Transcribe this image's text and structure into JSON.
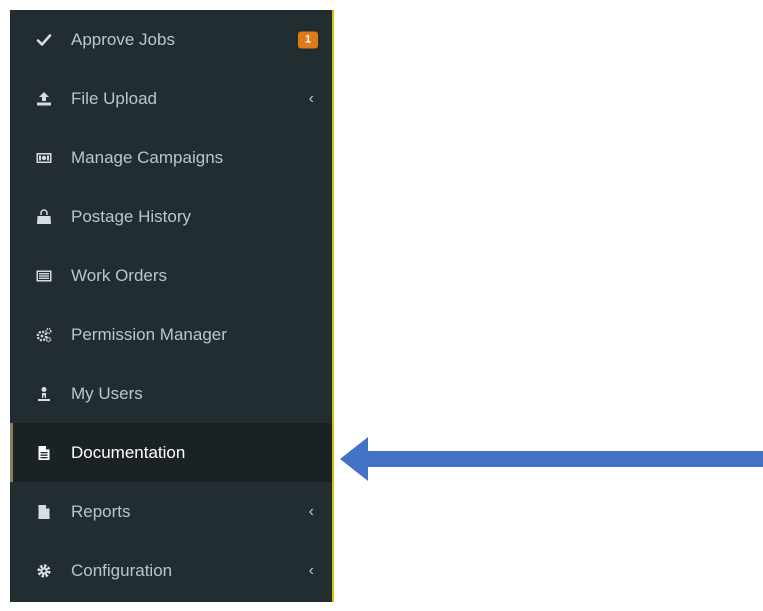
{
  "sidebar": {
    "items": [
      {
        "label": "Approve Jobs",
        "icon": "check-icon",
        "badge": "1"
      },
      {
        "label": "File Upload",
        "icon": "upload-icon",
        "chevron": "‹"
      },
      {
        "label": "Manage Campaigns",
        "icon": "money-icon"
      },
      {
        "label": "Postage History",
        "icon": "shopping-bag-icon"
      },
      {
        "label": "Work Orders",
        "icon": "list-alt-icon"
      },
      {
        "label": "Permission Manager",
        "icon": "cogs-icon"
      },
      {
        "label": "My Users",
        "icon": "user-icon"
      },
      {
        "label": "Documentation",
        "icon": "file-text-icon",
        "active": true
      },
      {
        "label": "Reports",
        "icon": "file-icon",
        "chevron": "‹"
      },
      {
        "label": "Configuration",
        "icon": "cog-icon",
        "chevron": "‹"
      }
    ]
  },
  "annotation": {
    "arrow_color": "#4472c4",
    "points_to": "Documentation"
  },
  "colors": {
    "sidebar_bg": "#222d32",
    "active_bg": "#1a2226",
    "badge": "#e07b1a",
    "border_accent": "#d6c200"
  }
}
